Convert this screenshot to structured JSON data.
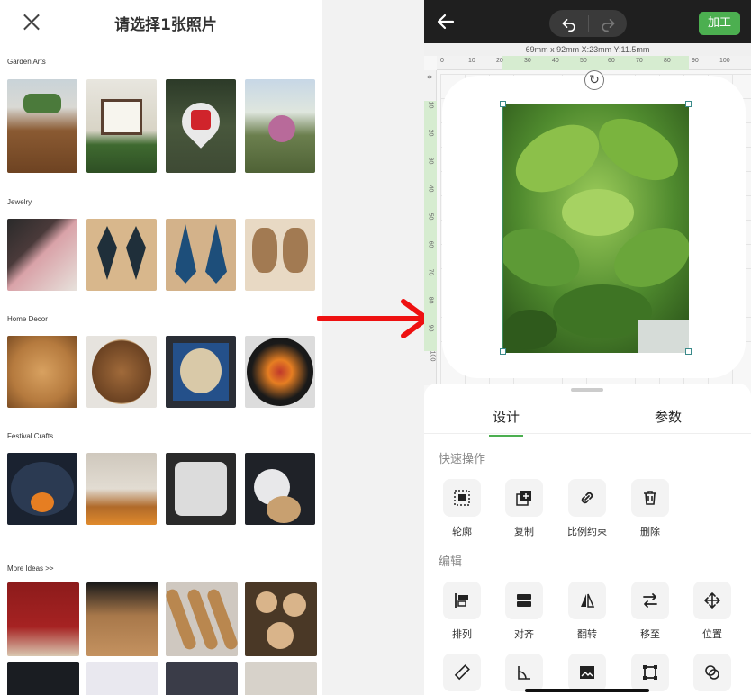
{
  "left_panel": {
    "title": "请选择1张照片",
    "sections": [
      {
        "label": "Garden Arts"
      },
      {
        "label": "Jewelry"
      },
      {
        "label": "Home Decor"
      },
      {
        "label": "Festival Crafts"
      },
      {
        "label": "More Ideas >>"
      }
    ]
  },
  "editor": {
    "process_label": "加工",
    "dimensions": "69mm x 92mm    X:23mm Y:11.5mm",
    "ruler_top_ticks": [
      "0",
      "10",
      "20",
      "30",
      "40",
      "50",
      "60",
      "70",
      "80",
      "90",
      "100"
    ],
    "ruler_left_ticks": [
      "0",
      "10",
      "20",
      "30",
      "40",
      "50",
      "60",
      "70",
      "80",
      "90",
      "100"
    ],
    "tabs": [
      {
        "label": "设计"
      },
      {
        "label": "参数"
      }
    ],
    "quick_ops": {
      "title": "快速操作",
      "items": [
        {
          "label": "轮廓",
          "icon": "outline-icon"
        },
        {
          "label": "复制",
          "icon": "copy-icon"
        },
        {
          "label": "比例约束",
          "icon": "link-icon"
        },
        {
          "label": "删除",
          "icon": "trash-icon"
        }
      ]
    },
    "edit_ops": {
      "title": "编辑",
      "items": [
        {
          "label": "排列",
          "icon": "arrange-icon"
        },
        {
          "label": "对齐",
          "icon": "align-icon"
        },
        {
          "label": "翻转",
          "icon": "flip-icon"
        },
        {
          "label": "移至",
          "icon": "move-to-icon"
        },
        {
          "label": "位置",
          "icon": "position-icon"
        }
      ]
    }
  },
  "colors": {
    "accent": "#4caf50",
    "dark_bar": "#1f1f1f",
    "arrow": "#ee1111"
  }
}
